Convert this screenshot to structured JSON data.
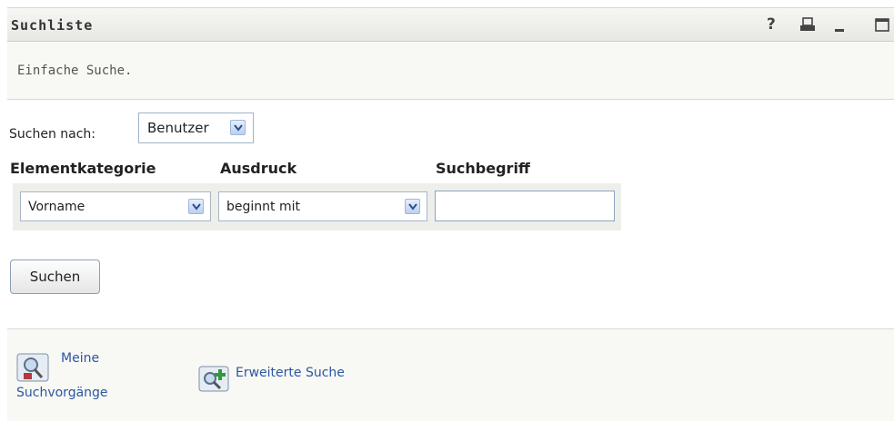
{
  "window": {
    "title": "Suchliste",
    "help_label": "?",
    "icons": [
      "help-icon",
      "print-icon",
      "minimize-icon",
      "maximize-icon"
    ]
  },
  "description": "Einfache Suche.",
  "search": {
    "search_for_label": "Suchen nach:",
    "search_for_value": "Benutzer",
    "columns": [
      "Elementkategorie",
      "Ausdruck",
      "Suchbegriff"
    ],
    "criterion": {
      "category": "Vorname",
      "expression": "beginnt mit",
      "term": ""
    },
    "submit_label": "Suchen"
  },
  "links": {
    "saved_searches_line1": "Meine",
    "saved_searches_line2": "Suchvorgänge",
    "advanced_search": "Erweiterte Suche"
  },
  "colors": {
    "link": "#2c57a3",
    "title_bar": "#ececE7",
    "panel": "#f8f8f4"
  }
}
